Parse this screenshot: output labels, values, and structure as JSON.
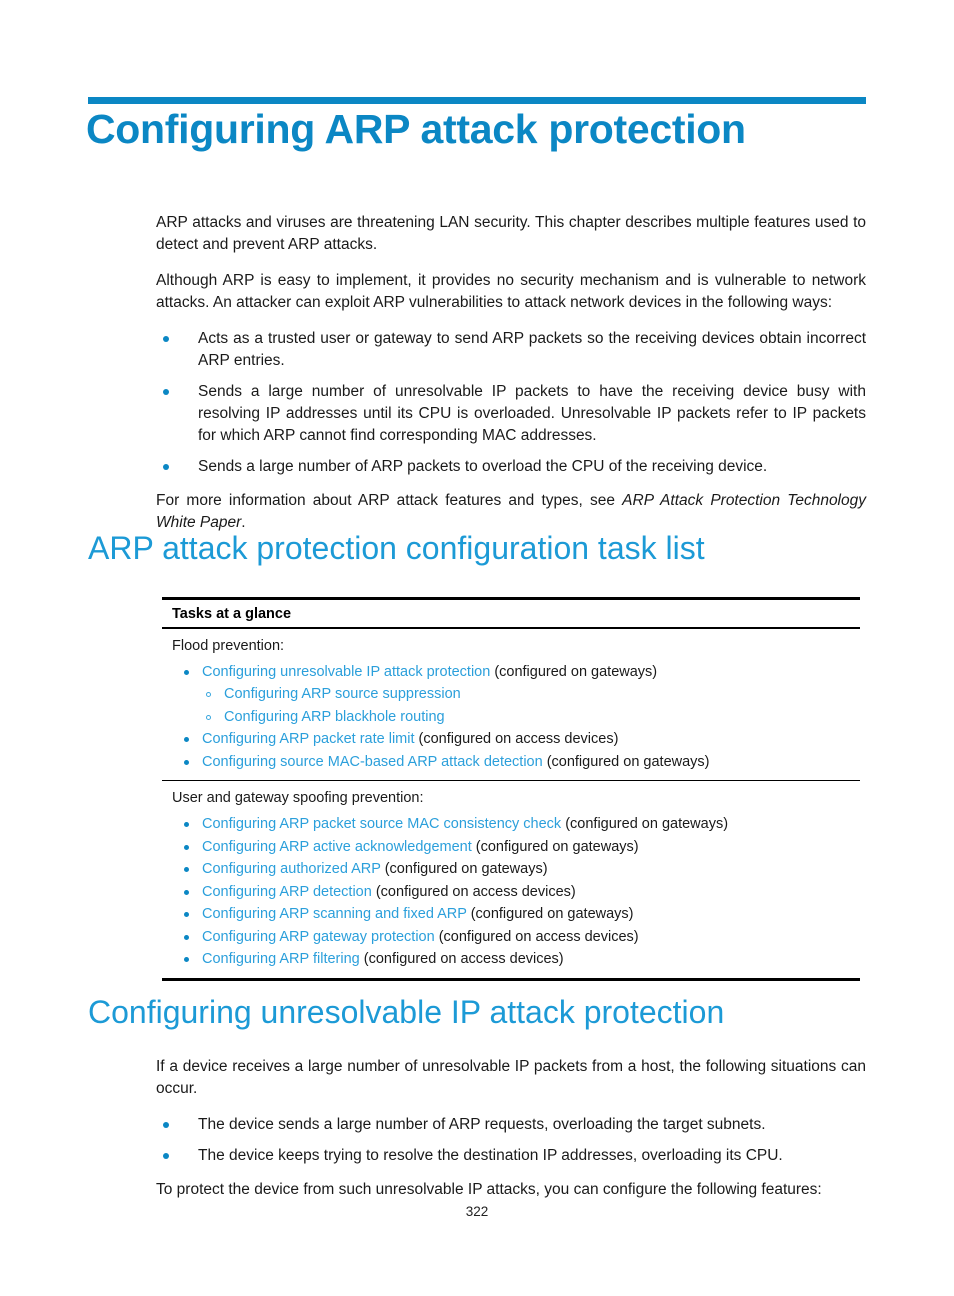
{
  "document": {
    "chapter_title": "Configuring ARP attack protection",
    "page_number": "322"
  },
  "intro": {
    "paragraph_1": "ARP attacks and viruses are threatening LAN security. This chapter describes multiple features used to detect and prevent ARP attacks.",
    "paragraph_2": "Although ARP is easy to implement, it provides no security mechanism and is vulnerable to network attacks. An attacker can exploit ARP vulnerabilities to attack network devices in the following ways:",
    "bullets": [
      "Acts as a trusted user or gateway to send ARP packets so the receiving devices obtain incorrect ARP entries.",
      "Sends a large number of unresolvable IP packets to have the receiving device busy with resolving IP addresses until its CPU is overloaded. Unresolvable IP packets refer to IP packets for which ARP cannot find corresponding MAC addresses.",
      "Sends a large number of ARP packets to overload the CPU of the receiving device."
    ],
    "closing_prefix": "For more information about ARP attack features and types, see ",
    "closing_italic": "ARP Attack Protection Technology White Paper",
    "closing_suffix": "."
  },
  "task_list_section": {
    "heading": "ARP attack protection configuration task list",
    "table_header": "Tasks at a glance",
    "groups": [
      {
        "label": "Flood prevention:",
        "tasks": [
          {
            "link": "Configuring unresolvable IP attack protection",
            "note": " (configured on gateways)",
            "subtasks": [
              {
                "link": "Configuring ARP source suppression",
                "note": ""
              },
              {
                "link": "Configuring ARP blackhole routing",
                "note": ""
              }
            ]
          },
          {
            "link": "Configuring ARP packet rate limit",
            "note": " (configured on access devices)",
            "subtasks": []
          },
          {
            "link": "Configuring source MAC-based ARP attack detection",
            "note": " (configured on gateways)",
            "subtasks": []
          }
        ]
      },
      {
        "label": "User and gateway spoofing prevention:",
        "tasks": [
          {
            "link": "Configuring ARP packet source MAC consistency check",
            "note": " (configured on gateways)",
            "subtasks": []
          },
          {
            "link": "Configuring ARP active acknowledgement",
            "note": " (configured on gateways)",
            "subtasks": []
          },
          {
            "link": "Configuring authorized ARP",
            "note": " (configured on gateways)",
            "subtasks": []
          },
          {
            "link": "Configuring ARP detection",
            "note": " (configured on access devices)",
            "subtasks": []
          },
          {
            "link": "Configuring ARP scanning and fixed ARP",
            "note": " (configured on gateways)",
            "subtasks": []
          },
          {
            "link": "Configuring ARP gateway protection",
            "note": " (configured on access devices)",
            "subtasks": []
          },
          {
            "link": "Configuring ARP filtering",
            "note": " (configured on access devices)",
            "subtasks": []
          }
        ]
      }
    ]
  },
  "unresolvable_section": {
    "heading": "Configuring unresolvable IP attack protection",
    "paragraph_1": "If a device receives a large number of unresolvable IP packets from a host, the following situations can occur.",
    "bullets": [
      "The device sends a large number of ARP requests, overloading the target subnets.",
      "The device keeps trying to resolve the destination IP addresses, overloading its CPU."
    ],
    "paragraph_2": "To protect the device from such unresolvable IP attacks, you can configure the following features:"
  },
  "colors": {
    "chapter_blue": "#0b87c4",
    "heading_blue": "#1c9ad6",
    "link_blue": "#2b9fdb",
    "bullet_blue": "#0b87c4"
  }
}
